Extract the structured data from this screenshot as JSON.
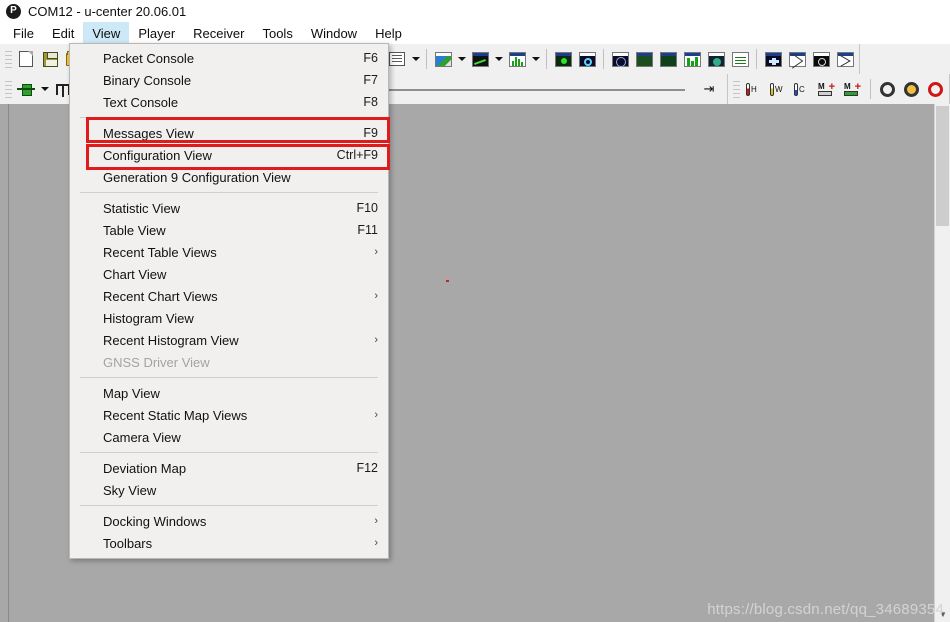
{
  "window": {
    "logo_letter": "P",
    "title": "COM12 - u-center 20.06.01"
  },
  "menubar": {
    "items": [
      {
        "label": "File",
        "active": false
      },
      {
        "label": "Edit",
        "active": false
      },
      {
        "label": "View",
        "active": true
      },
      {
        "label": "Player",
        "active": false
      },
      {
        "label": "Receiver",
        "active": false
      },
      {
        "label": "Tools",
        "active": false
      },
      {
        "label": "Window",
        "active": false
      },
      {
        "label": "Help",
        "active": false
      }
    ]
  },
  "toolbar_row1": {
    "icons": [
      "new-document-icon",
      "save-icon",
      "open-folder-icon",
      "sigma-icon",
      "table-grid-icon",
      "dropdown-arrow-icon",
      "map-view-icon",
      "dropdown-arrow-icon",
      "chart-view-icon",
      "dropdown-arrow-icon",
      "histogram-view-icon",
      "dropdown-arrow-icon",
      "scope-icon",
      "compass-icon",
      "sky-view-icon",
      "satellite-grid-icon",
      "deviation-map-icon",
      "bar-graph-icon",
      "globe-icon",
      "list-view-icon",
      "star-icon",
      "deviation-icon",
      "clock-icon",
      "scatter-icon"
    ]
  },
  "toolbar_row2": {
    "icons_left": [
      "connector-icon",
      "dropdown-arrow-icon",
      "pulse-icon"
    ],
    "slider": {
      "name": "player-position-slider",
      "value_percent": 0
    },
    "end_button": "jump-to-end-icon",
    "icons_right": [
      {
        "name": "thermometer-hot-icon",
        "label": "H",
        "color": "#d01616"
      },
      {
        "name": "thermometer-warm-icon",
        "label": "W",
        "color": "#dcc21a"
      },
      {
        "name": "thermometer-cold-icon",
        "label": "C",
        "color": "#1b4fd0"
      },
      {
        "name": "memory-add-grey-icon",
        "label": "M",
        "color": "#9a9a9a"
      },
      {
        "name": "memory-add-green-icon",
        "label": "M",
        "color": "#2fa02f"
      }
    ],
    "gears": [
      "config-gear-dark-icon",
      "config-gear-yellow-icon",
      "config-gear-red-icon"
    ]
  },
  "view_menu": {
    "groups": [
      {
        "rows": [
          {
            "label": "Packet Console",
            "accel": "F6",
            "submenu": false,
            "disabled": false,
            "highlight": false
          },
          {
            "label": "Binary Console",
            "accel": "F7",
            "submenu": false,
            "disabled": false,
            "highlight": false
          },
          {
            "label": "Text Console",
            "accel": "F8",
            "submenu": false,
            "disabled": false,
            "highlight": false
          }
        ]
      },
      {
        "rows": [
          {
            "label": "Messages View",
            "accel": "F9",
            "submenu": false,
            "disabled": false,
            "highlight": true
          },
          {
            "label": "Configuration View",
            "accel": "Ctrl+F9",
            "submenu": false,
            "disabled": false,
            "highlight": true
          },
          {
            "label": "Generation 9 Configuration View",
            "accel": "",
            "submenu": false,
            "disabled": false,
            "highlight": false
          }
        ]
      },
      {
        "rows": [
          {
            "label": "Statistic View",
            "accel": "F10",
            "submenu": false,
            "disabled": false,
            "highlight": false
          },
          {
            "label": "Table View",
            "accel": "F11",
            "submenu": false,
            "disabled": false,
            "highlight": false
          },
          {
            "label": "Recent Table Views",
            "accel": "",
            "submenu": true,
            "disabled": false,
            "highlight": false
          },
          {
            "label": "Chart View",
            "accel": "",
            "submenu": false,
            "disabled": false,
            "highlight": false
          },
          {
            "label": "Recent Chart Views",
            "accel": "",
            "submenu": true,
            "disabled": false,
            "highlight": false
          },
          {
            "label": "Histogram View",
            "accel": "",
            "submenu": false,
            "disabled": false,
            "highlight": false
          },
          {
            "label": "Recent Histogram View",
            "accel": "",
            "submenu": true,
            "disabled": false,
            "highlight": false
          },
          {
            "label": "GNSS Driver View",
            "accel": "",
            "submenu": false,
            "disabled": true,
            "highlight": false
          }
        ]
      },
      {
        "rows": [
          {
            "label": "Map View",
            "accel": "",
            "submenu": false,
            "disabled": false,
            "highlight": false
          },
          {
            "label": "Recent Static Map Views",
            "accel": "",
            "submenu": true,
            "disabled": false,
            "highlight": false
          },
          {
            "label": "Camera View",
            "accel": "",
            "submenu": false,
            "disabled": false,
            "highlight": false
          }
        ]
      },
      {
        "rows": [
          {
            "label": "Deviation Map",
            "accel": "F12",
            "submenu": false,
            "disabled": false,
            "highlight": false
          },
          {
            "label": "Sky View",
            "accel": "",
            "submenu": false,
            "disabled": false,
            "highlight": false
          }
        ]
      },
      {
        "rows": [
          {
            "label": "Docking Windows",
            "accel": "",
            "submenu": true,
            "disabled": false,
            "highlight": false
          },
          {
            "label": "Toolbars",
            "accel": "",
            "submenu": true,
            "disabled": false,
            "highlight": false
          }
        ]
      }
    ],
    "submenu_glyph": "›"
  },
  "annotations": {
    "color": "#e01b1b",
    "boxes": [
      {
        "name": "highlight-messages-view",
        "target": "Messages View"
      },
      {
        "name": "highlight-configuration-view",
        "target": "Configuration View"
      }
    ]
  },
  "workspace": {
    "scroll_up_glyph": "▲",
    "scroll_down_glyph": "▼"
  },
  "watermark": {
    "text": "https://blog.csdn.net/qq_34689354"
  }
}
